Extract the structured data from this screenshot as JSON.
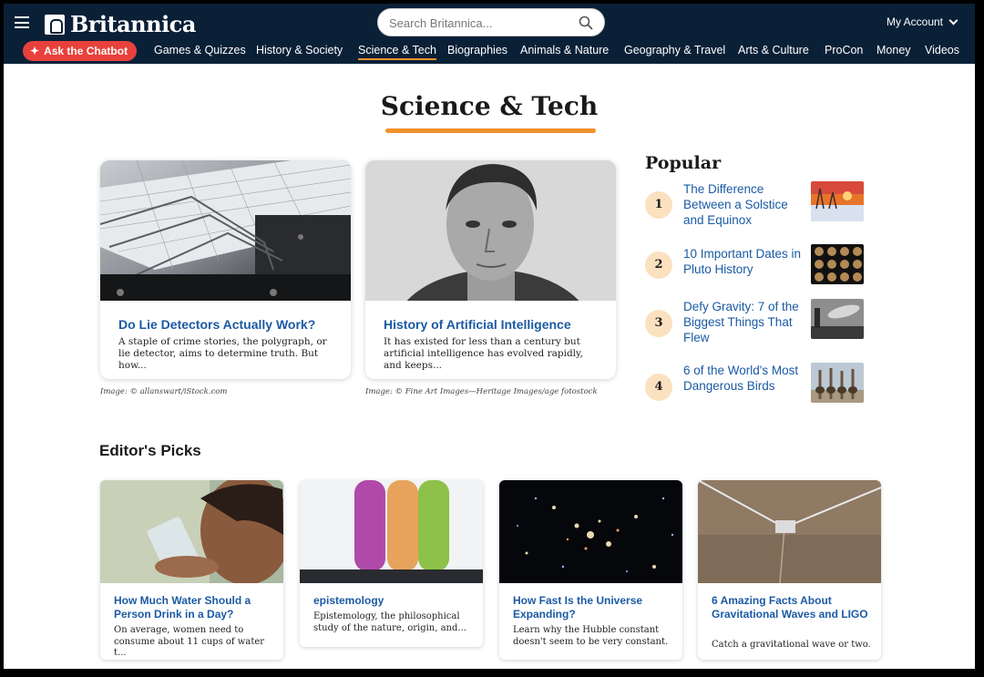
{
  "header": {
    "logo_text": "Britannica",
    "search_placeholder": "Search Britannica...",
    "account_label": "My Account",
    "chatbot_label": "Ask the Chatbot",
    "nav": [
      "Games & Quizzes",
      "History & Society",
      "Science & Tech",
      "Biographies",
      "Animals & Nature",
      "Geography & Travel",
      "Arts & Culture",
      "ProCon",
      "Money",
      "Videos"
    ],
    "active_nav": "Science & Tech"
  },
  "page": {
    "title": "Science & Tech"
  },
  "features": [
    {
      "title": "Do Lie Detectors Actually Work?",
      "desc": "A staple of crime stories, the polygraph, or lie detector, aims to determine truth. But how...",
      "credit": "Image: © allanswart/iStock.com",
      "image": "polygraph-image"
    },
    {
      "title": "History of Artificial Intelligence",
      "desc": "It has existed for less than a century but artificial intelligence has evolved rapidly, and keeps...",
      "credit": "Image: © Fine Art Images—Heritage Images/age fotostock",
      "image": "portrait-image"
    }
  ],
  "popular": {
    "title": "Popular",
    "items": [
      {
        "num": "1",
        "text": "The Difference Between a Solstice and Equinox",
        "thumb": "winter-sunset-thumb"
      },
      {
        "num": "2",
        "text": "10 Important Dates in Pluto History",
        "thumb": "pluto-grid-thumb"
      },
      {
        "num": "3",
        "text": "Defy Gravity: 7 of the Biggest Things That Flew",
        "thumb": "airship-thumb"
      },
      {
        "num": "4",
        "text": "6 of the World's Most Dangerous Birds",
        "thumb": "ostriches-thumb"
      }
    ]
  },
  "editors_picks": {
    "title": "Editor's Picks",
    "items": [
      {
        "title": "How Much Water Should a Person Drink in a Day?",
        "desc": "On average, women need to consume about 11 cups of water t...",
        "image": "woman-drinking-water-image"
      },
      {
        "title": "epistemology",
        "desc": "Epistemology, the philosophical study of the nature, origin, and...",
        "image": "test-tubes-image"
      },
      {
        "title": "How Fast Is the Universe Expanding?",
        "desc": "Learn why the Hubble constant doesn't seem to be very constant.",
        "image": "galaxies-image"
      },
      {
        "title": "6 Amazing Facts About Gravitational Waves and LIGO",
        "desc": "Catch a gravitational wave or two.",
        "image": "ligo-aerial-image"
      }
    ]
  },
  "colors": {
    "header_bg": "#0a2037",
    "accent_orange": "#f2922c",
    "link_blue": "#1b5aa4",
    "chatbot_red": "#e8413c"
  }
}
